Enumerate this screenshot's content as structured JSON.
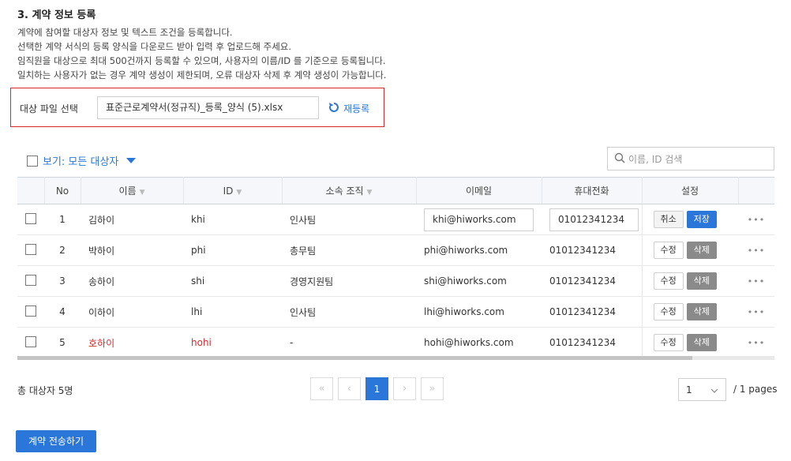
{
  "section": {
    "title": "3. 계약 정보 등록",
    "descriptions": [
      "계약에 참여할 대상자 정보 및 텍스트 조건을 등록합니다.",
      "선택한 계약 서식의 등록 양식을 다운로드 받아 입력 후 업로드해 주세요.",
      "임직원을 대상으로 최대 500건까지 등록할 수 있으며, 사용자의 이름/ID 를 기준으로 등록됩니다.",
      "일치하는 사용자가 없는 경우 계약 생성이 제한되며, 오류 대상자 삭제 후 계약 생성이 가능합니다."
    ]
  },
  "file": {
    "label": "대상 파일 선택",
    "filename": "표준근로계약서(정규직)_등록_양식 (5).xlsx",
    "reupload_label": "재등록",
    "reupload_icon": "refresh-icon"
  },
  "filter": {
    "view_label": "보기: 모든 대상자"
  },
  "search": {
    "placeholder": "이름, ID 검색"
  },
  "table": {
    "headers": [
      "No",
      "이름",
      "ID",
      "소속 조직",
      "이메일",
      "휴대전화",
      "설정"
    ],
    "rows": [
      {
        "no": "1",
        "name": "김하이",
        "id": "khi",
        "org": "인사팀",
        "email": "khi@hiworks.com",
        "phone": "01012341234",
        "btn1": "취소",
        "btn2": "저장",
        "editing": true,
        "error": false
      },
      {
        "no": "2",
        "name": "박하이",
        "id": "phi",
        "org": "총무팀",
        "email": "phi@hiworks.com",
        "phone": "01012341234",
        "btn1": "수정",
        "btn2": "삭제",
        "editing": false,
        "error": false
      },
      {
        "no": "3",
        "name": "송하이",
        "id": "shi",
        "org": "경영지원팀",
        "email": "shi@hiworks.com",
        "phone": "01012341234",
        "btn1": "수정",
        "btn2": "삭제",
        "editing": false,
        "error": false
      },
      {
        "no": "4",
        "name": "이하이",
        "id": "lhi",
        "org": "인사팀",
        "email": "lhi@hiworks.com",
        "phone": "01012341234",
        "btn1": "수정",
        "btn2": "삭제",
        "editing": false,
        "error": false
      },
      {
        "no": "5",
        "name": "호하이",
        "id": "hohi",
        "org": "-",
        "email": "hohi@hiworks.com",
        "phone": "01012341234",
        "btn1": "수정",
        "btn2": "삭제",
        "editing": false,
        "error": true
      }
    ],
    "more_label": "•••"
  },
  "footer": {
    "total": "총 대상자 5명",
    "current_page": "1",
    "page_select_value": "1",
    "pages_text": "/ 1 pages",
    "pager_icons": {
      "first": "«",
      "prev": "‹",
      "next": "›",
      "last": "»"
    }
  },
  "actions": {
    "send_label": "계약 전송하기"
  },
  "colors": {
    "accent": "#2b77d9",
    "error": "#d6272d",
    "header_bg": "#f5f7fa"
  }
}
